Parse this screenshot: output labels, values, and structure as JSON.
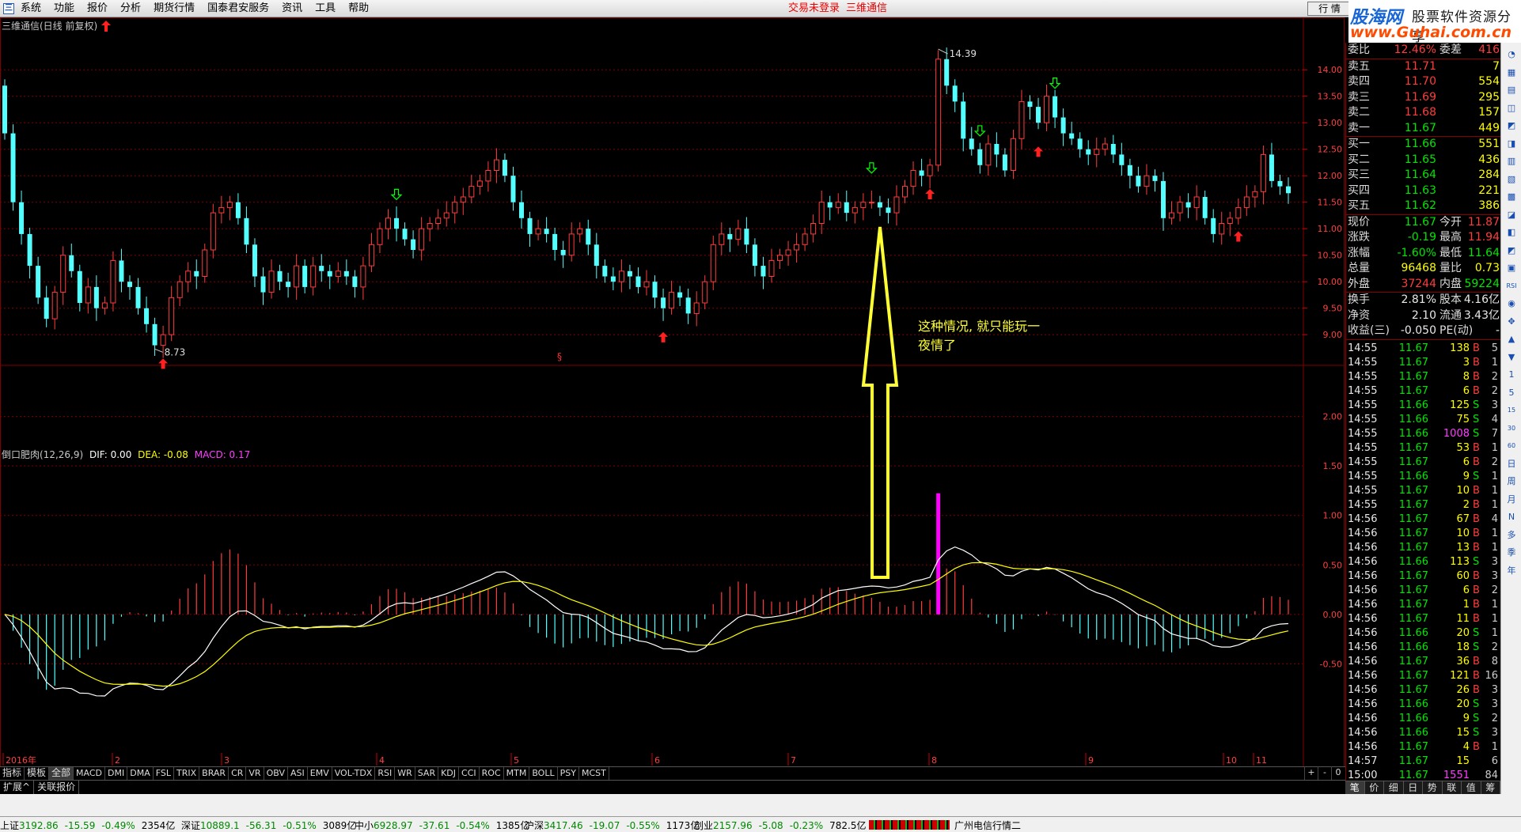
{
  "menubar": {
    "logo_glyph": "三",
    "items": [
      "系统",
      "功能",
      "报价",
      "分析",
      "期货行情",
      "国泰君安服务",
      "资讯",
      "工具",
      "帮助"
    ],
    "login_status": "交易未登录",
    "stock_name": "三维通信",
    "quote_button": "行 情",
    "minimize": "_"
  },
  "logo_banner": {
    "line1": "股海网",
    "line2": "股票软件资源分享",
    "line3": "www.Guhai.com.cn"
  },
  "chart": {
    "title": "三维通信(日线 前复权)",
    "macd_title_prefix": "倒口肥肉(12,26,9)",
    "dif_label": "DIF: 0.00",
    "dea_label": "DEA: -0.08",
    "macd_label": "MACD: 0.17",
    "high_label": "14.39",
    "low_label": "8.73",
    "section_mark": "§",
    "annotation_line1": "这种情况, 就只能玩一",
    "annotation_line2": "夜情了",
    "timeframe": "日线",
    "colors": {
      "up": "#ff3c3c",
      "down": "#54ffff",
      "dif": "#ffffff",
      "dea": "#ffff00",
      "macd_highlight": "#ff00ff",
      "grid": "#800000",
      "annotation": "#ffff33"
    }
  },
  "chart_data": [
    {
      "type": "candlestick",
      "title": "三维通信(日线 前复权)",
      "price_axis_ticks": [
        "14.00",
        "13.50",
        "13.00",
        "12.50",
        "12.00",
        "11.50",
        "11.00",
        "10.50",
        "10.00",
        "9.50",
        "9.00"
      ],
      "date_axis_ticks": [
        "2016年",
        "2",
        "3",
        "4",
        "5",
        "6",
        "7",
        "8",
        "9",
        "10",
        "11"
      ],
      "ylim": [
        8.6,
        14.6
      ],
      "marked_high": 14.39,
      "marked_low": 8.73,
      "close_approx": [
        12.8,
        11.5,
        10.9,
        10.3,
        9.7,
        9.3,
        9.8,
        10.5,
        10.2,
        9.6,
        9.9,
        9.5,
        9.6,
        10.4,
        10.0,
        9.9,
        9.5,
        9.2,
        8.8,
        9.0,
        9.7,
        10.0,
        10.2,
        10.1,
        10.6,
        11.3,
        11.4,
        11.5,
        11.2,
        10.7,
        10.1,
        9.8,
        10.2,
        10.0,
        9.9,
        10.3,
        9.9,
        10.3,
        10.2,
        10.1,
        10.2,
        10.1,
        9.9,
        10.3,
        10.7,
        11.0,
        11.2,
        11.0,
        10.8,
        10.6,
        11.0,
        11.1,
        11.2,
        11.3,
        11.5,
        11.6,
        11.8,
        11.9,
        12.1,
        12.3,
        12.0,
        11.5,
        11.2,
        10.9,
        11.0,
        10.9,
        10.6,
        10.5,
        10.9,
        11.0,
        10.7,
        10.3,
        10.1,
        10.0,
        10.2,
        10.1,
        9.9,
        10.0,
        9.7,
        9.5,
        9.8,
        9.7,
        9.4,
        9.6,
        10.0,
        10.7,
        10.9,
        10.8,
        11.0,
        10.7,
        10.3,
        10.1,
        10.4,
        10.5,
        10.6,
        10.7,
        10.9,
        11.1,
        11.5,
        11.4,
        11.5,
        11.3,
        11.4,
        11.5,
        11.5,
        11.4,
        11.3,
        11.6,
        11.8,
        12.1,
        12.0,
        12.2,
        14.2,
        13.7,
        13.4,
        12.7,
        12.5,
        12.2,
        12.6,
        12.4,
        12.1,
        12.7,
        13.4,
        13.3,
        13.0,
        13.5,
        13.1,
        12.8,
        12.7,
        12.5,
        12.4,
        12.5,
        12.6,
        12.4,
        12.2,
        12.0,
        11.8,
        12.0,
        11.9,
        11.2,
        11.3,
        11.5,
        11.4,
        11.6,
        11.2,
        10.9,
        11.1,
        11.2,
        11.4,
        11.6,
        11.7,
        12.4,
        11.9,
        11.8,
        11.67
      ]
    },
    {
      "type": "bar",
      "title": "倒口肥肉(12,26,9)",
      "series_names": [
        "DIF",
        "DEA",
        "MACD"
      ],
      "y_axis_ticks": [
        "2.00",
        "1.50",
        "1.00",
        "0.50",
        "0.00",
        "-0.50"
      ],
      "ylim": [
        -1.4,
        2.5
      ],
      "dif_last": 0.0,
      "dea_last": -0.08,
      "macd_last": 0.17
    }
  ],
  "quote_panel": {
    "ratio_row": {
      "label": "委比",
      "ratio": "12.46%",
      "label2": "委差",
      "diff": "416"
    },
    "asks": [
      {
        "label": "卖五",
        "price": "11.71",
        "vol": "7"
      },
      {
        "label": "卖四",
        "price": "11.70",
        "vol": "554"
      },
      {
        "label": "卖三",
        "price": "11.69",
        "vol": "295"
      },
      {
        "label": "卖二",
        "price": "11.68",
        "vol": "157"
      },
      {
        "label": "卖一",
        "price": "11.67",
        "vol": "449"
      }
    ],
    "bids": [
      {
        "label": "买一",
        "price": "11.66",
        "vol": "551"
      },
      {
        "label": "买二",
        "price": "11.65",
        "vol": "436"
      },
      {
        "label": "买三",
        "price": "11.64",
        "vol": "284"
      },
      {
        "label": "买四",
        "price": "11.63",
        "vol": "221"
      },
      {
        "label": "买五",
        "price": "11.62",
        "vol": "386"
      }
    ],
    "stats": [
      {
        "l1": "现价",
        "v1": "11.67",
        "l2": "今开",
        "v2": "11.87",
        "c1": "green",
        "c2": "red"
      },
      {
        "l1": "涨跌",
        "v1": "-0.19",
        "l2": "最高",
        "v2": "11.94",
        "c1": "green",
        "c2": "red"
      },
      {
        "l1": "涨幅",
        "v1": "-1.60%",
        "l2": "最低",
        "v2": "11.64",
        "c1": "green",
        "c2": "green"
      },
      {
        "l1": "总量",
        "v1": "96468",
        "l2": "量比",
        "v2": "0.73",
        "c1": "yellow",
        "c2": "yellow"
      },
      {
        "l1": "外盘",
        "v1": "37244",
        "l2": "内盘",
        "v2": "59224",
        "c1": "red",
        "c2": "green"
      }
    ],
    "stats2": [
      {
        "l1": "换手",
        "v1": "2.81%",
        "l2": "股本",
        "v2": "4.16亿",
        "c1": "white",
        "c2": "white"
      },
      {
        "l1": "净资",
        "v1": "2.10",
        "l2": "流通",
        "v2": "3.43亿",
        "c1": "white",
        "c2": "white"
      },
      {
        "l1": "收益(三)",
        "v1": "-0.050",
        "l2": "PE(动)",
        "v2": "-",
        "c1": "white",
        "c2": "white"
      }
    ],
    "ticks": [
      {
        "t": "14:55",
        "p": "11.67",
        "v": "138",
        "bs": "B",
        "n": "5"
      },
      {
        "t": "14:55",
        "p": "11.67",
        "v": "3",
        "bs": "B",
        "n": "1"
      },
      {
        "t": "14:55",
        "p": "11.67",
        "v": "8",
        "bs": "B",
        "n": "2"
      },
      {
        "t": "14:55",
        "p": "11.67",
        "v": "6",
        "bs": "B",
        "n": "2"
      },
      {
        "t": "14:55",
        "p": "11.66",
        "v": "125",
        "bs": "S",
        "n": "3"
      },
      {
        "t": "14:55",
        "p": "11.66",
        "v": "75",
        "bs": "S",
        "n": "4"
      },
      {
        "t": "14:55",
        "p": "11.66",
        "v": "1008",
        "bs": "S",
        "n": "7"
      },
      {
        "t": "14:55",
        "p": "11.67",
        "v": "53",
        "bs": "B",
        "n": "1"
      },
      {
        "t": "14:55",
        "p": "11.67",
        "v": "6",
        "bs": "B",
        "n": "2"
      },
      {
        "t": "14:55",
        "p": "11.66",
        "v": "9",
        "bs": "S",
        "n": "1"
      },
      {
        "t": "14:55",
        "p": "11.67",
        "v": "10",
        "bs": "B",
        "n": "1"
      },
      {
        "t": "14:55",
        "p": "11.67",
        "v": "2",
        "bs": "B",
        "n": "1"
      },
      {
        "t": "14:56",
        "p": "11.67",
        "v": "67",
        "bs": "B",
        "n": "4"
      },
      {
        "t": "14:56",
        "p": "11.67",
        "v": "10",
        "bs": "B",
        "n": "1"
      },
      {
        "t": "14:56",
        "p": "11.67",
        "v": "13",
        "bs": "B",
        "n": "1"
      },
      {
        "t": "14:56",
        "p": "11.66",
        "v": "113",
        "bs": "S",
        "n": "3"
      },
      {
        "t": "14:56",
        "p": "11.67",
        "v": "60",
        "bs": "B",
        "n": "3"
      },
      {
        "t": "14:56",
        "p": "11.67",
        "v": "6",
        "bs": "B",
        "n": "2"
      },
      {
        "t": "14:56",
        "p": "11.67",
        "v": "1",
        "bs": "B",
        "n": "1"
      },
      {
        "t": "14:56",
        "p": "11.67",
        "v": "11",
        "bs": "B",
        "n": "1"
      },
      {
        "t": "14:56",
        "p": "11.66",
        "v": "20",
        "bs": "S",
        "n": "1"
      },
      {
        "t": "14:56",
        "p": "11.66",
        "v": "18",
        "bs": "S",
        "n": "2"
      },
      {
        "t": "14:56",
        "p": "11.67",
        "v": "36",
        "bs": "B",
        "n": "8"
      },
      {
        "t": "14:56",
        "p": "11.67",
        "v": "121",
        "bs": "B",
        "n": "16"
      },
      {
        "t": "14:56",
        "p": "11.67",
        "v": "26",
        "bs": "B",
        "n": "3"
      },
      {
        "t": "14:56",
        "p": "11.66",
        "v": "20",
        "bs": "S",
        "n": "3"
      },
      {
        "t": "14:56",
        "p": "11.66",
        "v": "9",
        "bs": "S",
        "n": "2"
      },
      {
        "t": "14:56",
        "p": "11.66",
        "v": "15",
        "bs": "S",
        "n": "3"
      },
      {
        "t": "14:56",
        "p": "11.67",
        "v": "4",
        "bs": "B",
        "n": "1"
      },
      {
        "t": "14:57",
        "p": "11.67",
        "v": "15",
        "bs": "",
        "n": "6"
      },
      {
        "t": "15:00",
        "p": "11.67",
        "v": "1551",
        "bs": "",
        "n": "84"
      }
    ],
    "tabs": [
      "笔",
      "价",
      "细",
      "日",
      "势",
      "联",
      "值",
      "筹"
    ]
  },
  "side_toolbar": [
    "◔",
    "▦",
    "▤",
    "◫",
    "◩",
    "◨",
    "▥",
    "▧",
    "▩",
    "◪",
    "◧",
    "◩",
    "▣",
    "RSI",
    "◉",
    "✥",
    "▲",
    "▼",
    "1",
    "5",
    "15",
    "30",
    "60",
    "日",
    "周",
    "月",
    "N",
    "多",
    "季",
    "年"
  ],
  "indicator_tabs": [
    "指标",
    "模板",
    "全部",
    "MACD",
    "DMI",
    "DMA",
    "FSL",
    "TRIX",
    "BRAR",
    "CR",
    "VR",
    "OBV",
    "ASI",
    "EMV",
    "VOL-TDX",
    "RSI",
    "WR",
    "SAR",
    "KDJ",
    "CCI",
    "ROC",
    "MTM",
    "BOLL",
    "PSY",
    "MCST"
  ],
  "bottom_tabs": [
    "扩展^",
    "关联报价"
  ],
  "zoom_ctrl": [
    "+",
    "-",
    "0"
  ],
  "status_bar": {
    "sh": {
      "name": "上证",
      "val": "3192.86",
      "chg": "-15.59",
      "pct": "-0.49%",
      "amt": "2354亿"
    },
    "sz": {
      "name": "深证",
      "val": "10889.1",
      "chg": "-56.31",
      "pct": "-0.51%",
      "amt": "3089亿"
    },
    "zx": {
      "name": "中小",
      "val": "6928.97",
      "chg": "-37.61",
      "pct": "-0.54%",
      "amt": "1385亿"
    },
    "hs": {
      "name": "沪深",
      "val": "3417.46",
      "chg": "-19.07",
      "pct": "-0.55%",
      "amt": "1173亿"
    },
    "cy": {
      "name": "创业",
      "val": "2157.96",
      "chg": "-5.08",
      "pct": "-0.23%",
      "amt": "782.5亿"
    },
    "server": "广州电信行情二"
  }
}
